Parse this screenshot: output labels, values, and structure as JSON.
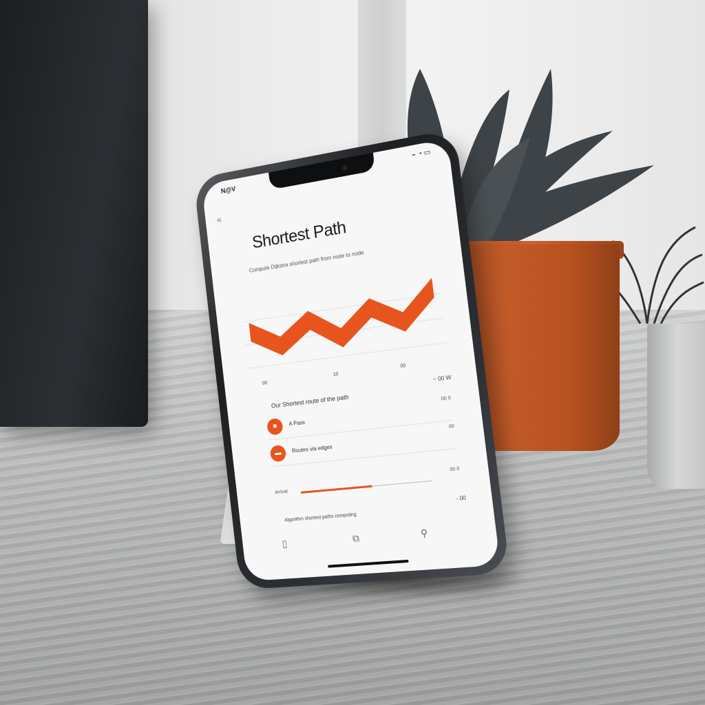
{
  "status_bar": {
    "left": "N@V",
    "right": "⌁ ◔ ▭"
  },
  "nav": {
    "back_label": "«"
  },
  "header": {
    "title": "Shortest Path",
    "subtitle": "Compute Dijkstra shortest path from node to node"
  },
  "chart_data": {
    "type": "area",
    "title": "",
    "x_ticks": [
      "00",
      "10",
      "00"
    ],
    "series": [
      {
        "values": [
          2,
          1,
          2.2,
          1,
          2.4,
          1.4,
          3
        ]
      }
    ],
    "color": "#e8541d",
    "grid": true
  },
  "section": {
    "label": "Our Shortest route of the path",
    "right_value": "~ 00 W"
  },
  "list": {
    "items": [
      {
        "icon": "■",
        "text": "A Pass",
        "value": "00 0"
      },
      {
        "icon": "▬",
        "text": "Routes via edges",
        "value": "00"
      },
      {
        "icon": "",
        "text": "",
        "value": "00"
      }
    ]
  },
  "progress": {
    "label": "Arrival",
    "fraction": 0.55,
    "value": "00 0"
  },
  "footer": {
    "text": "Algorithm shortest paths computing",
    "right": "- 00"
  },
  "tabs": [
    {
      "icon": "document-icon",
      "glyph": "▯"
    },
    {
      "icon": "map-icon",
      "glyph": "⧉"
    },
    {
      "icon": "search-icon",
      "glyph": "⚲"
    }
  ],
  "colors": {
    "accent": "#e8541d",
    "pot": "#c25a28"
  }
}
